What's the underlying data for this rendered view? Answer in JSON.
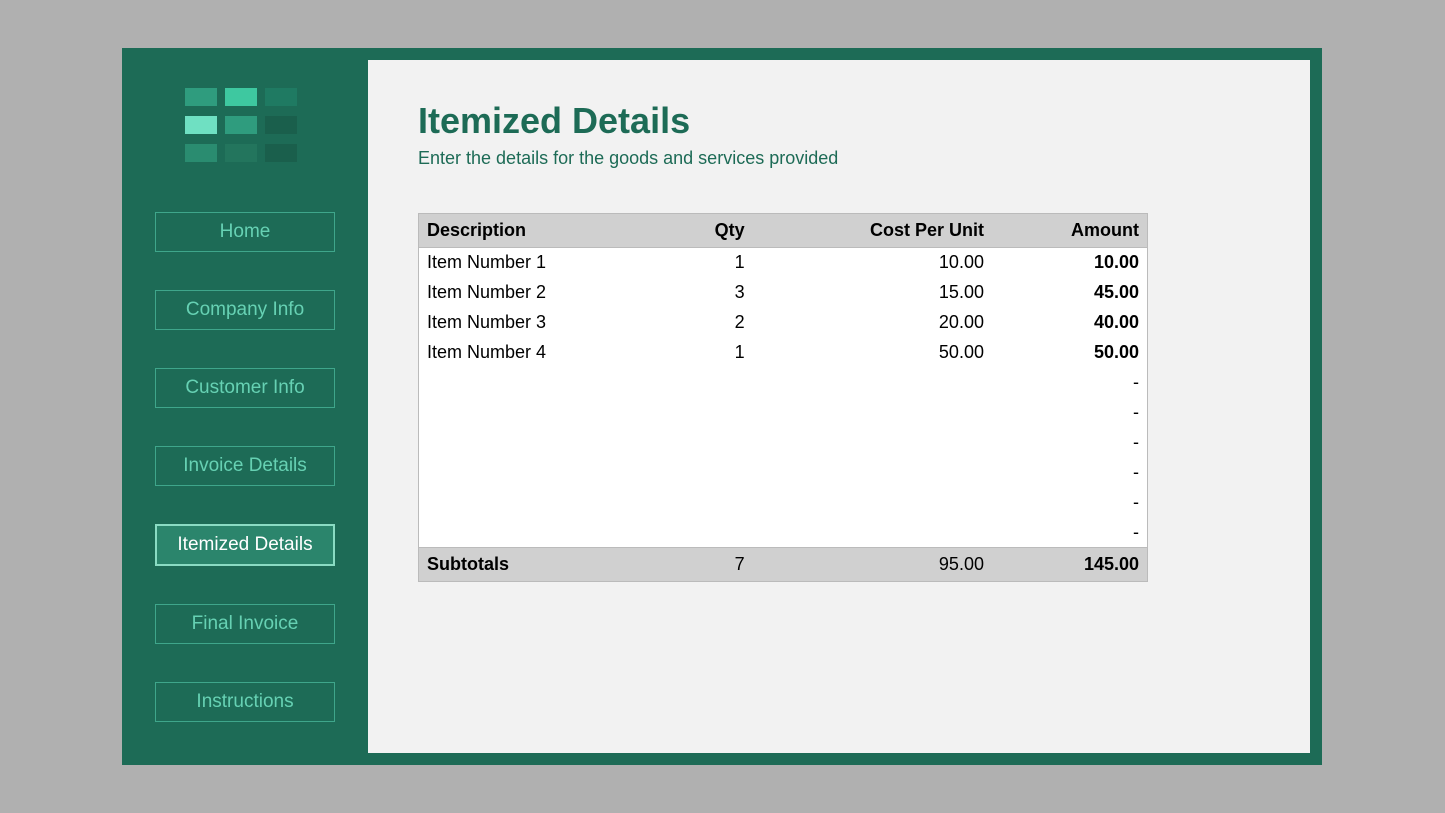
{
  "sidebar": {
    "items": [
      {
        "label": "Home",
        "active": false
      },
      {
        "label": "Company Info",
        "active": false
      },
      {
        "label": "Customer Info",
        "active": false
      },
      {
        "label": "Invoice Details",
        "active": false
      },
      {
        "label": "Itemized Details",
        "active": true
      },
      {
        "label": "Final Invoice",
        "active": false
      },
      {
        "label": "Instructions",
        "active": false
      }
    ],
    "logo_colors": [
      [
        "#2f9c7e",
        "#3ec8a0",
        "#1f7a62"
      ],
      [
        "#6fe0c2",
        "#2f9c7e",
        "#1a5f4c"
      ],
      [
        "#2a8c70",
        "#23755d",
        "#1a5f4c"
      ]
    ]
  },
  "page": {
    "title": "Itemized Details",
    "subtitle": "Enter the details for the goods and services provided"
  },
  "table": {
    "headers": {
      "description": "Description",
      "qty": "Qty",
      "cost_per_unit": "Cost Per Unit",
      "amount": "Amount"
    },
    "rows": [
      {
        "description": "Item Number 1",
        "qty": "1",
        "cost_per_unit": "10.00",
        "amount": "10.00"
      },
      {
        "description": "Item Number 2",
        "qty": "3",
        "cost_per_unit": "15.00",
        "amount": "45.00"
      },
      {
        "description": "Item Number 3",
        "qty": "2",
        "cost_per_unit": "20.00",
        "amount": "40.00"
      },
      {
        "description": "Item Number 4",
        "qty": "1",
        "cost_per_unit": "50.00",
        "amount": "50.00"
      },
      {
        "description": "",
        "qty": "",
        "cost_per_unit": "",
        "amount": "-"
      },
      {
        "description": "",
        "qty": "",
        "cost_per_unit": "",
        "amount": "-"
      },
      {
        "description": "",
        "qty": "",
        "cost_per_unit": "",
        "amount": "-"
      },
      {
        "description": "",
        "qty": "",
        "cost_per_unit": "",
        "amount": "-"
      },
      {
        "description": "",
        "qty": "",
        "cost_per_unit": "",
        "amount": "-"
      },
      {
        "description": "",
        "qty": "",
        "cost_per_unit": "",
        "amount": "-"
      }
    ],
    "subtotals": {
      "label": "Subtotals",
      "qty": "7",
      "cost_per_unit": "95.00",
      "amount": "145.00"
    }
  }
}
